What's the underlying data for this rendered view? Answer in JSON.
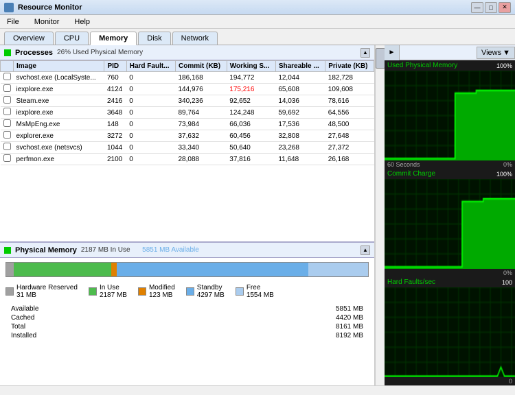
{
  "titleBar": {
    "title": "Resource Monitor",
    "icon": "monitor-icon"
  },
  "menuBar": {
    "items": [
      "File",
      "Monitor",
      "Help"
    ]
  },
  "tabs": {
    "items": [
      "Overview",
      "CPU",
      "Memory",
      "Disk",
      "Network"
    ],
    "active": "Memory"
  },
  "processesSection": {
    "title": "Processes",
    "indicator": "26% Used Physical Memory",
    "columns": [
      "Image",
      "PID",
      "Hard Fault...",
      "Commit (KB)",
      "Working S...",
      "Shareable ...",
      "Private (KB)"
    ],
    "rows": [
      [
        "svchost.exe (LocalSyste...",
        "760",
        "0",
        "186,168",
        "194,772",
        "12,044",
        "182,728"
      ],
      [
        "iexplore.exe",
        "4124",
        "0",
        "144,976",
        "175,216",
        "65,608",
        "109,608"
      ],
      [
        "Steam.exe",
        "2416",
        "0",
        "340,236",
        "92,652",
        "14,036",
        "78,616"
      ],
      [
        "iexplore.exe",
        "3648",
        "0",
        "89,764",
        "124,248",
        "59,692",
        "64,556"
      ],
      [
        "MsMpEng.exe",
        "148",
        "0",
        "73,984",
        "66,036",
        "17,536",
        "48,500"
      ],
      [
        "explorer.exe",
        "3272",
        "0",
        "37,632",
        "60,456",
        "32,808",
        "27,648"
      ],
      [
        "svchost.exe (netsvcs)",
        "1044",
        "0",
        "33,340",
        "50,640",
        "23,268",
        "27,372"
      ],
      [
        "perfmon.exe",
        "2100",
        "0",
        "28,088",
        "37,816",
        "11,648",
        "26,168"
      ]
    ]
  },
  "physicalMemorySection": {
    "title": "Physical Memory",
    "inUseLabel": "2187 MB In Use",
    "availableLabel": "5851 MB Available",
    "legend": {
      "hardwareReserved": {
        "label": "Hardware Reserved",
        "value": "31 MB"
      },
      "inUse": {
        "label": "In Use",
        "value": "2187 MB"
      },
      "modified": {
        "label": "Modified",
        "value": "123 MB"
      },
      "standby": {
        "label": "Standby",
        "value": "4297 MB"
      },
      "free": {
        "label": "Free",
        "value": "1554 MB"
      }
    },
    "stats": [
      {
        "label": "Available",
        "value": "5851 MB"
      },
      {
        "label": "Cached",
        "value": "4420 MB"
      },
      {
        "label": "Total",
        "value": "8161 MB"
      },
      {
        "label": "Installed",
        "value": "8192 MB"
      }
    ]
  },
  "graphPanel": {
    "viewsLabel": "Views",
    "graphs": [
      {
        "title": "Used Physical Memory",
        "pct": "100%",
        "bottom_left": "60 Seconds",
        "bottom_right": "0%"
      },
      {
        "title": "Commit Charge",
        "pct": "100%",
        "bottom_left": "",
        "bottom_right": "0%"
      },
      {
        "title": "Hard Faults/sec",
        "pct": "100",
        "bottom_left": "",
        "bottom_right": "0"
      }
    ]
  }
}
